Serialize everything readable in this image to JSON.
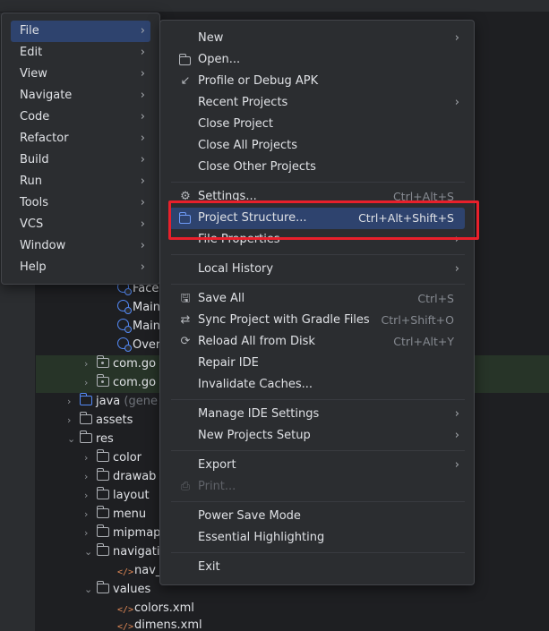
{
  "main_menu": [
    {
      "label": "File",
      "selected": true
    },
    {
      "label": "Edit"
    },
    {
      "label": "View"
    },
    {
      "label": "Navigate"
    },
    {
      "label": "Code"
    },
    {
      "label": "Refactor"
    },
    {
      "label": "Build"
    },
    {
      "label": "Run"
    },
    {
      "label": "Tools"
    },
    {
      "label": "VCS"
    },
    {
      "label": "Window"
    },
    {
      "label": "Help"
    }
  ],
  "file_menu": {
    "new": "New",
    "open": "Open...",
    "profile_apk": "Profile or Debug APK",
    "recent_projects": "Recent Projects",
    "close_project": "Close Project",
    "close_all_projects": "Close All Projects",
    "close_other_projects": "Close Other Projects",
    "settings": "Settings...",
    "settings_shortcut": "Ctrl+Alt+S",
    "project_structure": "Project Structure...",
    "project_structure_shortcut": "Ctrl+Alt+Shift+S",
    "file_properties": "File Properties",
    "local_history": "Local History",
    "save_all": "Save All",
    "save_all_shortcut": "Ctrl+S",
    "sync_gradle": "Sync Project with Gradle Files",
    "sync_gradle_shortcut": "Ctrl+Shift+O",
    "reload_all": "Reload All from Disk",
    "reload_all_shortcut": "Ctrl+Alt+Y",
    "repair_ide": "Repair IDE",
    "invalidate_caches": "Invalidate Caches...",
    "manage_ide_settings": "Manage IDE Settings",
    "new_projects_setup": "New Projects Setup",
    "export": "Export",
    "print": "Print...",
    "power_save_mode": "Power Save Mode",
    "essential_highlighting": "Essential Highlighting",
    "exit": "Exit"
  },
  "project_tree": {
    "face": "Face",
    "main1": "Main",
    "main2": "Main",
    "over": "Over",
    "pkg1": "com.go",
    "pkg2": "com.go",
    "java_generated": "java",
    "java_generated_suffix": "(gene",
    "assets": "assets",
    "res": "res",
    "color": "color",
    "drawable": "drawab",
    "layout": "layout",
    "menu": "menu",
    "mipmap": "mipmap",
    "navigation": "navigati",
    "nav_file": "nav_",
    "values": "values",
    "colors_xml": "colors.xml",
    "dimens_xml": "dimens.xml"
  },
  "colors": {
    "menu_bg": "#2b2d30",
    "selection": "#2e436e",
    "highlight_box": "#e8202b",
    "accent_blue": "#548af7"
  }
}
